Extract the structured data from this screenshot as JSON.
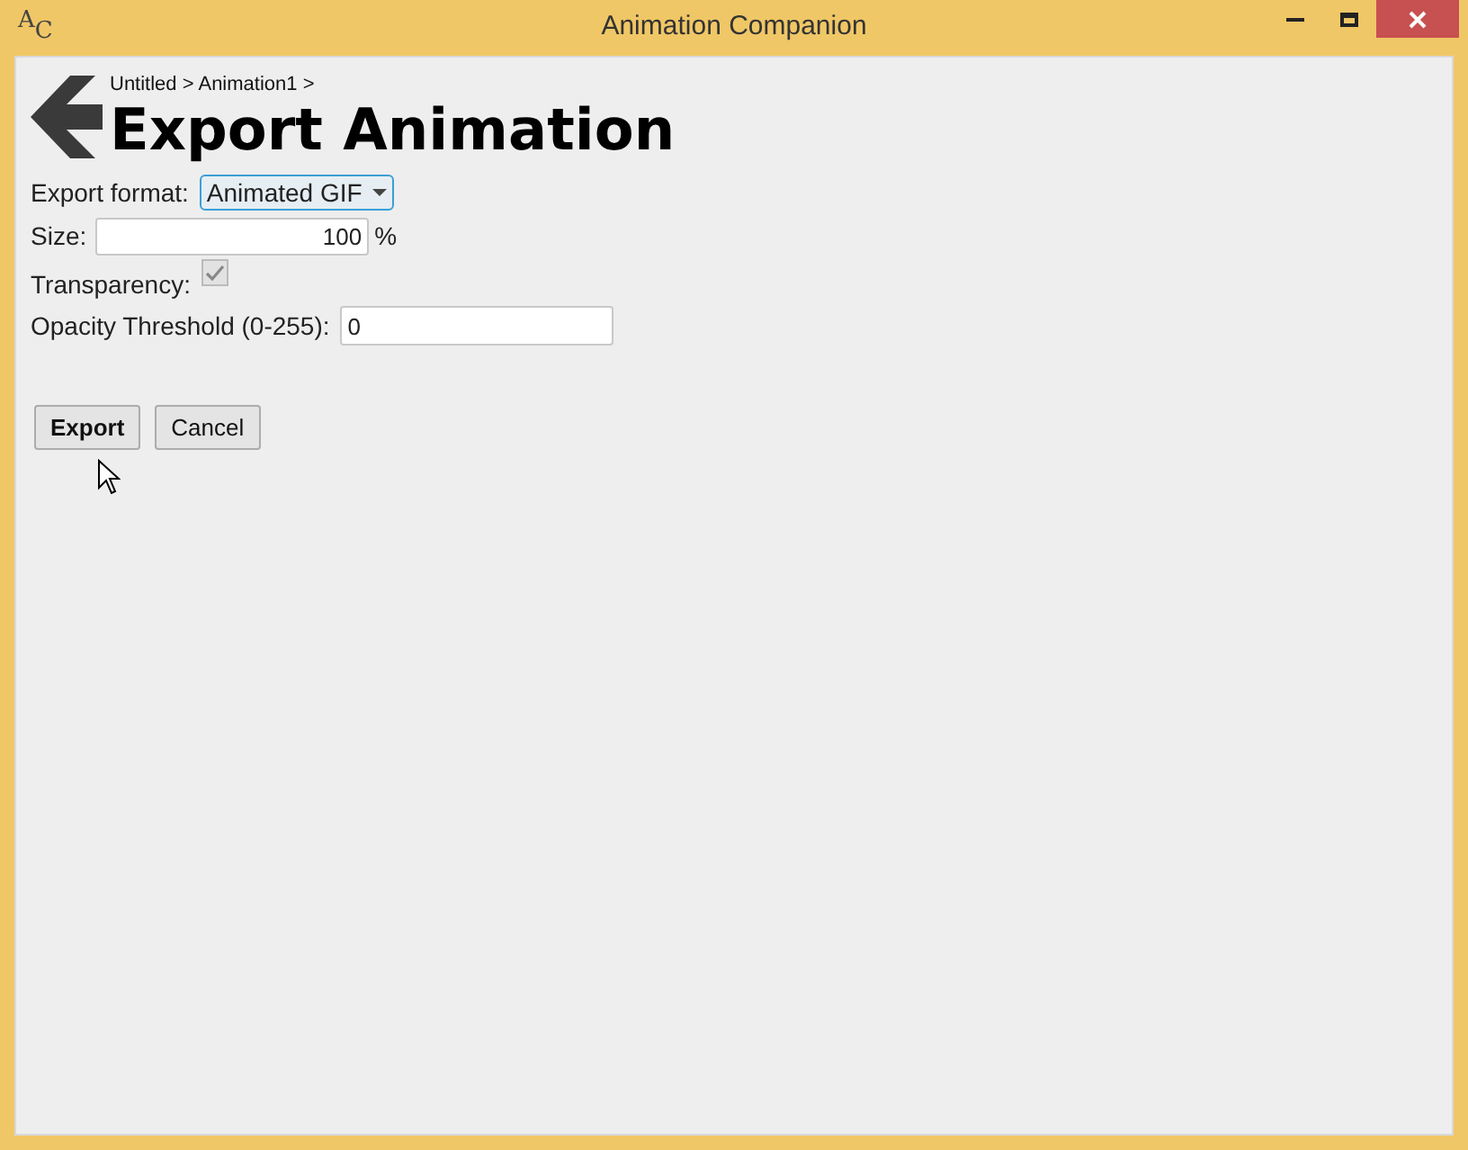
{
  "window": {
    "title": "Animation Companion",
    "app_icon": "AC"
  },
  "breadcrumb": "Untitled > Animation1 >",
  "heading": "Export Animation",
  "form": {
    "export_format": {
      "label": "Export format:",
      "value": "Animated GIF"
    },
    "size": {
      "label": "Size:",
      "value": "100",
      "unit": "%"
    },
    "transparency": {
      "label": "Transparency:",
      "checked": true
    },
    "opacity_threshold": {
      "label": "Opacity Threshold (0-255):",
      "value": "0"
    }
  },
  "buttons": [
    {
      "label": "Export",
      "default": true
    },
    {
      "label": "Cancel",
      "default": false
    }
  ]
}
